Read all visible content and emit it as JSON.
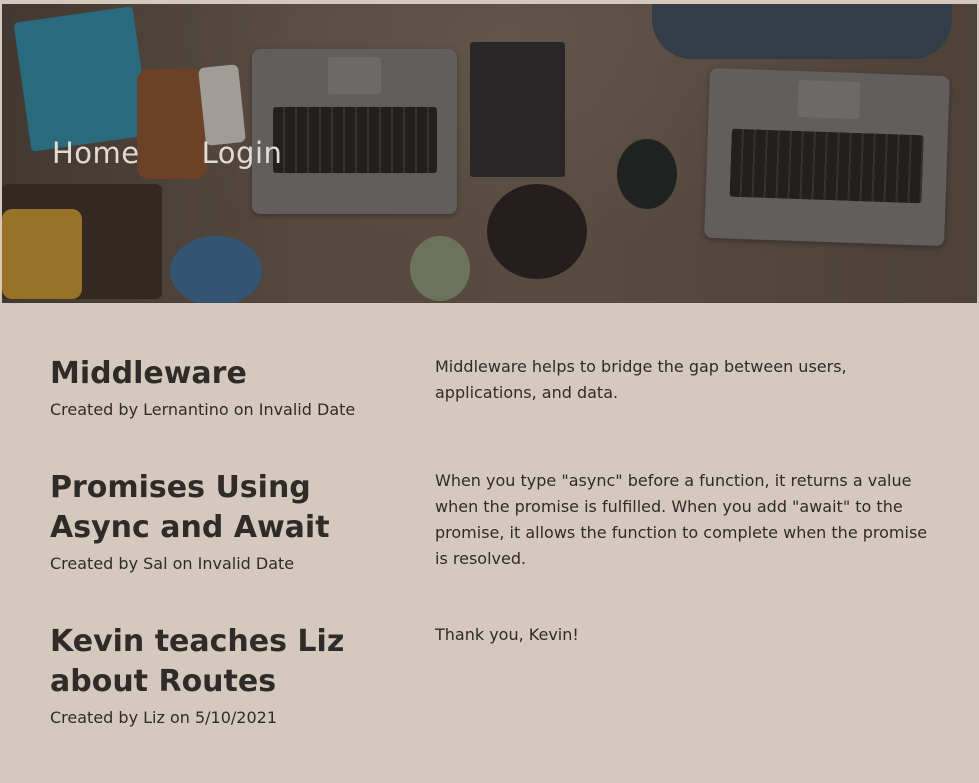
{
  "nav": {
    "home_label": "Home",
    "login_label": "Login"
  },
  "posts": [
    {
      "title": "Middleware",
      "meta": "Created by Lernantino on Invalid Date",
      "body": "Middleware helps to bridge the gap between users, applications, and data."
    },
    {
      "title": "Promises Using Async and Await",
      "meta": "Created by Sal on Invalid Date",
      "body": "When you type \"async\" before a function, it returns a value when the promise is fulfilled. When you add \"await\" to the promise, it allows the function to complete when the promise is resolved."
    },
    {
      "title": "Kevin teaches Liz about Routes",
      "meta": "Created by Liz on 5/10/2021",
      "body": "Thank you, Kevin!"
    }
  ],
  "colors": {
    "page_background": "#d5c9be",
    "text": "#2f2b28",
    "nav_text": "#e2dbd4"
  }
}
